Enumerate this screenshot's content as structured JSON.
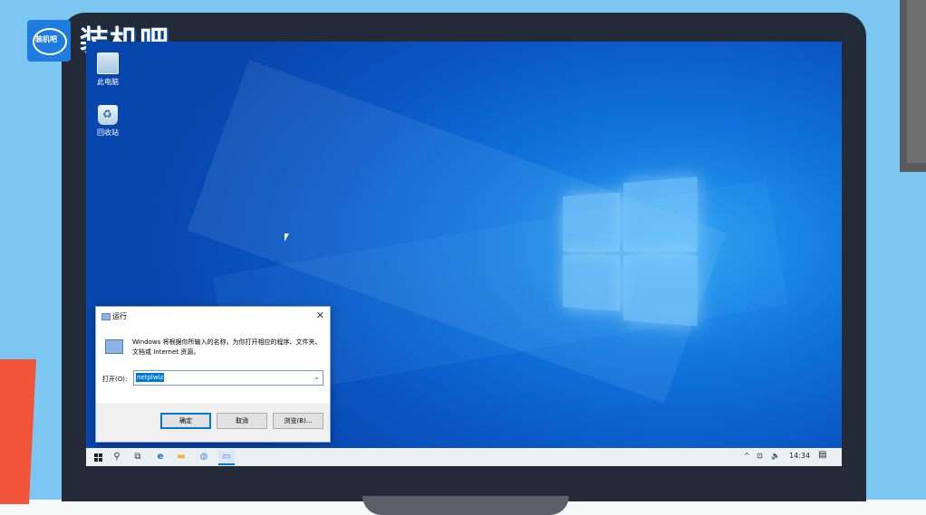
{
  "watermark": {
    "logo_text": "装机吧",
    "badge_text": "装机吧"
  },
  "desktop": {
    "icons": [
      {
        "label": "此电脑",
        "icon": "computer-icon"
      },
      {
        "label": "回收站",
        "icon": "recycle-bin-icon"
      }
    ]
  },
  "run_dialog": {
    "title": "运行",
    "close_glyph": "✕",
    "description": "Windows 将根据你所输入的名称，为你打开相应的程序、文件夹、文档或 Internet 资源。",
    "open_label": "打开(O):",
    "input_value": "netplwiz",
    "ok_label": "确定",
    "cancel_label": "取消",
    "browse_label": "浏览(B)..."
  },
  "taskbar": {
    "items": [
      "windows-start-icon",
      "search-icon",
      "task-view-icon",
      "edge-icon",
      "file-explorer-icon",
      "ie-icon",
      "run-app-icon"
    ],
    "tray_chevron": "^",
    "network_glyph": "⊡",
    "volume_glyph": "🔈",
    "clock": "14:34",
    "notification_glyph": "▤"
  },
  "colors": {
    "accent": "#0078d7",
    "desktop_blue": "#0a56c4",
    "background": "#7cc7f2"
  }
}
